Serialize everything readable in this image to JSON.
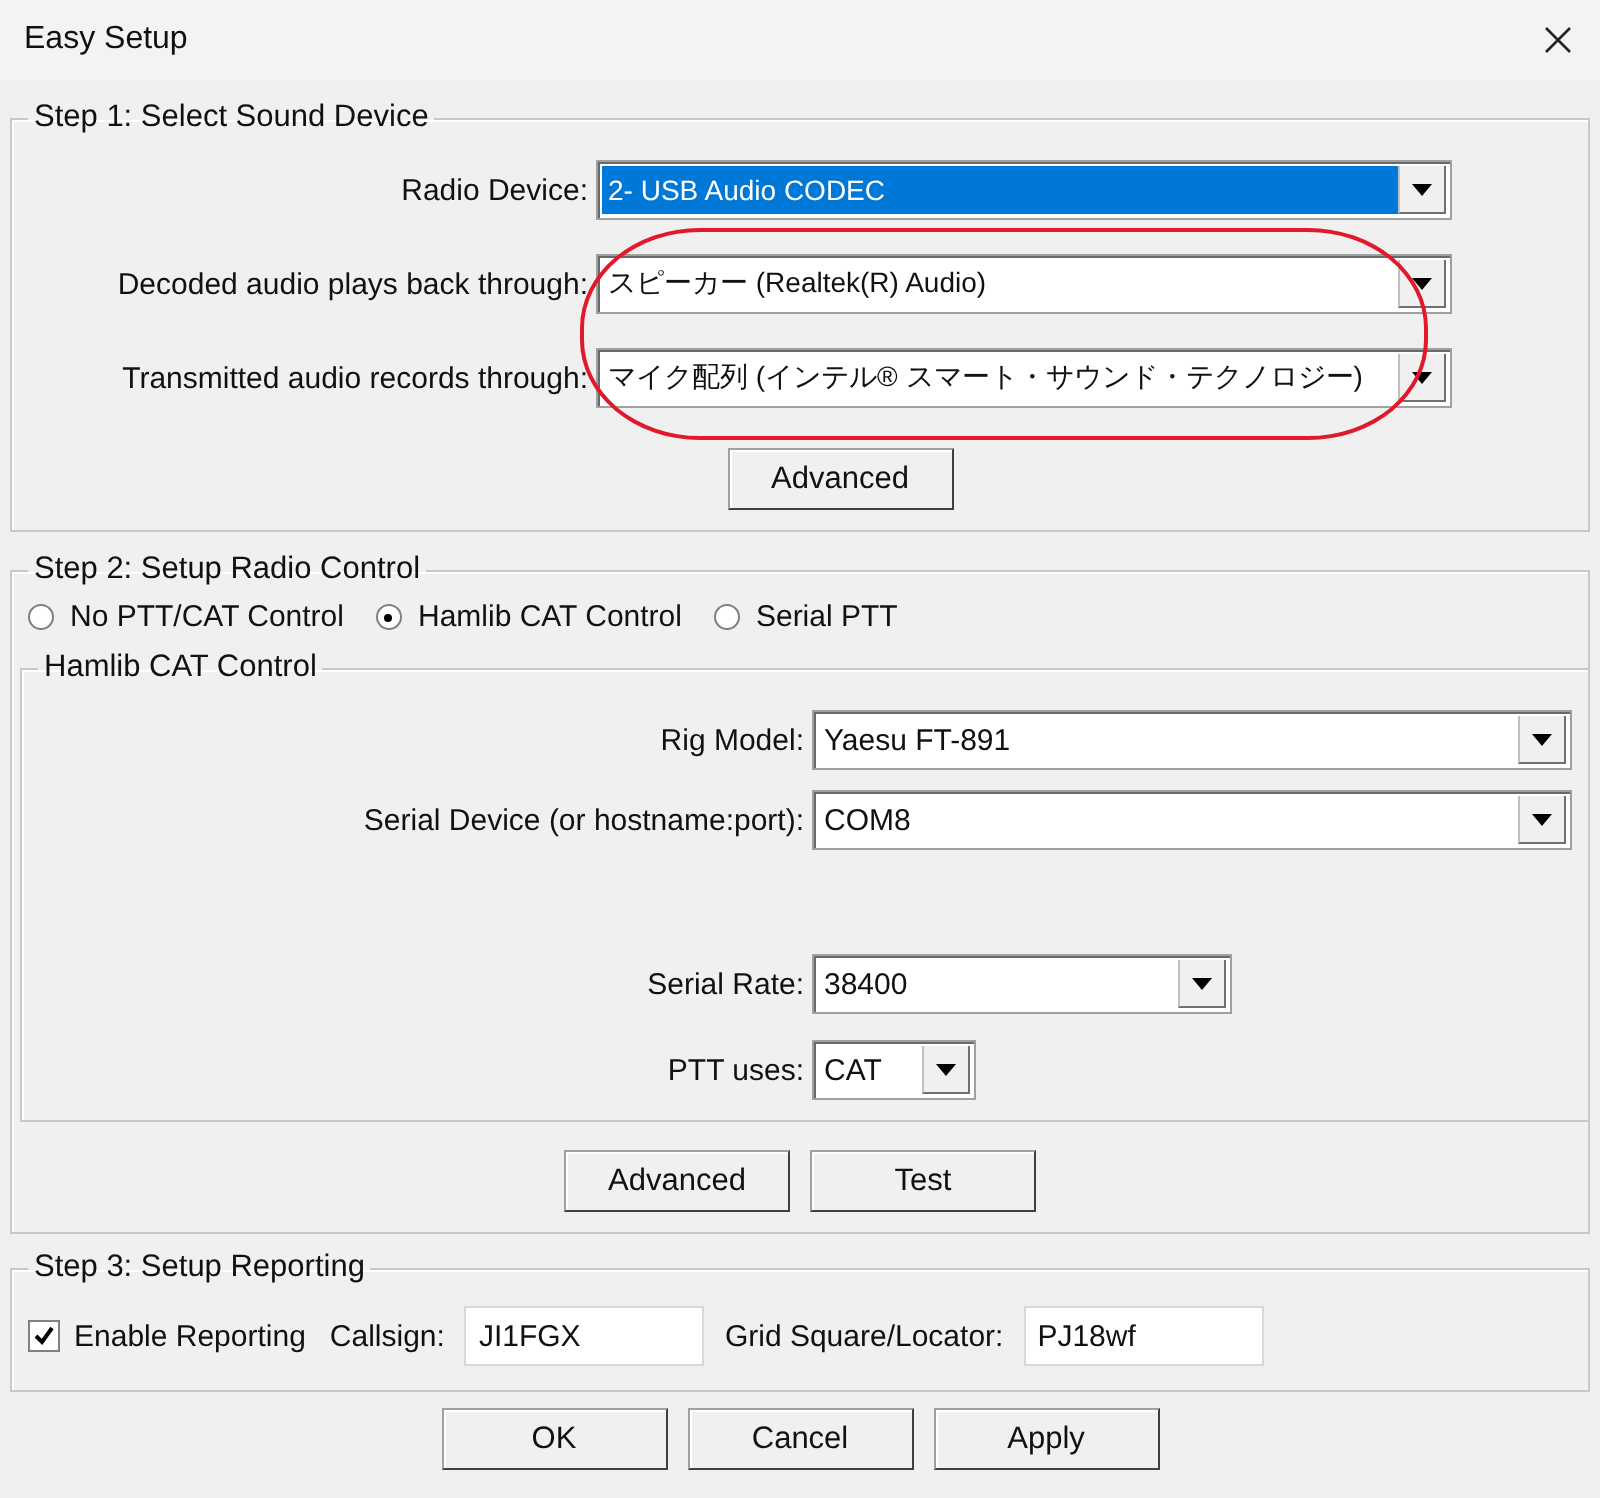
{
  "window": {
    "title": "Easy Setup"
  },
  "step1": {
    "title": "Step 1: Select Sound Device",
    "fields": [
      {
        "label": "Radio Device:",
        "value": "2- USB Audio CODEC",
        "focused": true
      },
      {
        "label": "Decoded audio plays back through:",
        "value": "スピーカー (Realtek(R) Audio)",
        "focused": false
      },
      {
        "label": "Transmitted audio records through:",
        "value": "マイク配列 (インテル® スマート・サウンド・テクノロジー)",
        "focused": false
      }
    ],
    "button": "Advanced"
  },
  "step2": {
    "title": "Step 2: Setup Radio Control",
    "modes": [
      {
        "label": "No PTT/CAT Control",
        "selected": false
      },
      {
        "label": "Hamlib CAT Control",
        "selected": true
      },
      {
        "label": "Serial PTT",
        "selected": false
      }
    ],
    "hamlib": {
      "title": "Hamlib CAT Control",
      "fields": [
        {
          "label": "Rig Model:",
          "value": "Yaesu FT-891",
          "kind": "wide"
        },
        {
          "label": "Serial Device (or hostname:port):",
          "value": "COM8",
          "kind": "wide"
        },
        {
          "label": "Serial Rate:",
          "value": "38400",
          "kind": "medium"
        },
        {
          "label": "PTT uses:",
          "value": "CAT",
          "kind": "small"
        }
      ]
    },
    "buttons": [
      "Advanced",
      "Test"
    ]
  },
  "step3": {
    "title": "Step 3: Setup Reporting",
    "enable": {
      "label": "Enable Reporting",
      "checked": true
    },
    "callsign": {
      "label": "Callsign:",
      "value": "JI1FGX"
    },
    "grid": {
      "label": "Grid Square/Locator:",
      "value": "PJ18wf"
    }
  },
  "buttons": [
    "OK",
    "Cancel",
    "Apply"
  ]
}
